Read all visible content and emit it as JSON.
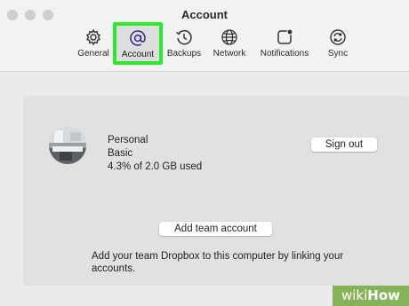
{
  "window": {
    "title": "Account"
  },
  "tabs": [
    {
      "label": "General",
      "icon": "gear-icon"
    },
    {
      "label": "Account",
      "icon": "at-sign-icon"
    },
    {
      "label": "Backups",
      "icon": "clock-history-icon"
    },
    {
      "label": "Network",
      "icon": "globe-icon"
    },
    {
      "label": "Notifications",
      "icon": "notification-badge-icon"
    },
    {
      "label": "Sync",
      "icon": "sync-icon"
    }
  ],
  "active_tab": "Account",
  "account": {
    "name": "Personal",
    "plan": "Basic",
    "usage": "4.3% of 2.0 GB used",
    "signout_label": "Sign out"
  },
  "team": {
    "add_label": "Add team account",
    "description": "Add your team Dropbox to this computer by linking your accounts."
  },
  "watermark": {
    "prefix": "wiki",
    "suffix": "How"
  },
  "colors": {
    "highlight": "#2ee82e",
    "watermark_bg": "#86b25a"
  }
}
